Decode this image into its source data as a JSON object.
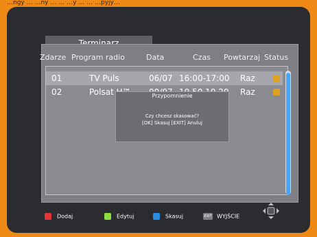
{
  "top_text": "…ngy … …ny … … …y … … …pyjy…",
  "title": "Terminarz",
  "columns": [
    "Zdarze",
    "Program radio",
    "Data",
    "Czas",
    "Powtarzaj",
    "Status"
  ],
  "rows": [
    {
      "id": "01",
      "program": "TV Puls",
      "date": "06/07",
      "time": "16:00-17:00",
      "repeat": "Raz",
      "status_color": "#e0a020"
    },
    {
      "id": "02",
      "program": "Polsat H™",
      "date": "00/07",
      "time": "10.50 10.20",
      "repeat": "Raz",
      "status_color": "#e0a020"
    }
  ],
  "dialog": {
    "title": "Przypomnienie",
    "message_line1": "Czy chcesz skasować?",
    "message_line2": "[OK] Skasuj [EXIT] Anuluj"
  },
  "footer": {
    "items": [
      {
        "label": "Dodaj",
        "color": "#e33535"
      },
      {
        "label": "Edytuj",
        "color": "#8ddf3f"
      },
      {
        "label": "Skasuj",
        "color": "#2a8de6"
      }
    ],
    "exit_key": "EXIT",
    "exit_label": "WYJŚCIE"
  },
  "colors": {
    "frame": "#f08a17",
    "background": "#2b2c30",
    "panel": "#7e7f85",
    "selected_row": "#a6a7ad",
    "scrollbar": "#4aa5ff"
  }
}
